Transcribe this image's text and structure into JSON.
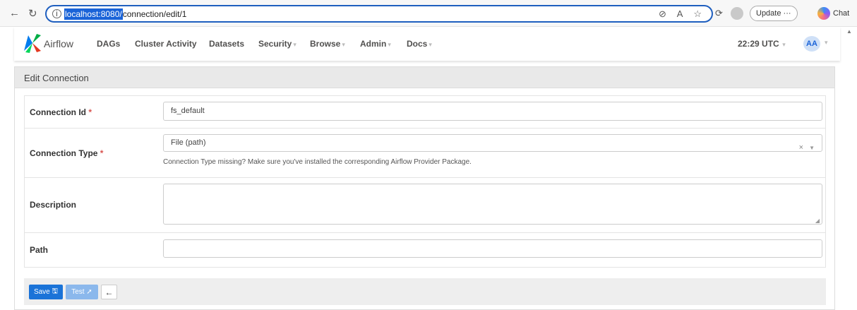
{
  "browser": {
    "url_host": "localhost:8080/",
    "url_path": "connection/edit/1",
    "update_label": "Update",
    "update_more": "···",
    "chat_label": "Chat"
  },
  "navbar": {
    "brand": "Airflow",
    "items": [
      {
        "label": "DAGs",
        "dropdown": false
      },
      {
        "label": "Cluster Activity",
        "dropdown": false
      },
      {
        "label": "Datasets",
        "dropdown": false
      },
      {
        "label": "Security",
        "dropdown": true
      },
      {
        "label": "Browse",
        "dropdown": true
      },
      {
        "label": "Admin",
        "dropdown": true
      },
      {
        "label": "Docs",
        "dropdown": true
      }
    ],
    "clock": "22:29 UTC",
    "avatar": "AA"
  },
  "panel": {
    "title": "Edit Connection"
  },
  "form": {
    "conn_id_label": "Connection Id",
    "conn_id_value": "fs_default",
    "conn_type_label": "Connection Type",
    "conn_type_value": "File (path)",
    "conn_type_help": "Connection Type missing? Make sure you've installed the corresponding Airflow Provider Package.",
    "description_label": "Description",
    "description_value": "",
    "path_label": "Path",
    "path_value": "",
    "required_mark": "*"
  },
  "buttons": {
    "save": "Save",
    "test": "Test",
    "back": "←"
  },
  "colors": {
    "primary": "#1a73d8",
    "required": "#d9534f",
    "url_highlight": "#1a63d8"
  }
}
